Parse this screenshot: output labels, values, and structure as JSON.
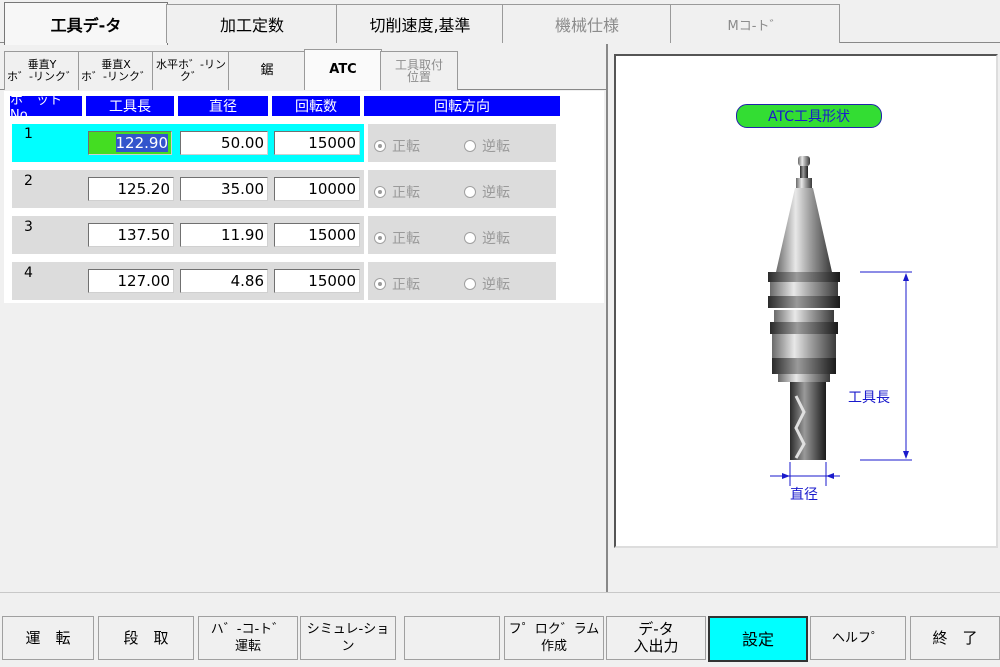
{
  "main_tabs": [
    {
      "label": "工具デ-タ",
      "state": "active"
    },
    {
      "label": "加工定数",
      "state": "normal"
    },
    {
      "label": "切削速度,基準",
      "state": "normal"
    },
    {
      "label": "機械仕様",
      "state": "disabled"
    },
    {
      "label": "Mコ-ト゛",
      "state": "disabled"
    }
  ],
  "sub_tabs": [
    {
      "label": "垂直Y\nホ゛-リンク゛",
      "state": "normal"
    },
    {
      "label": "垂直X\nホ゛-リンク゛",
      "state": "normal"
    },
    {
      "label": "水平ホ゛-リン\nク゛",
      "state": "normal"
    },
    {
      "label": "鋸",
      "state": "normal"
    },
    {
      "label": "ATC",
      "state": "active"
    },
    {
      "label": "工具取付\n位置",
      "state": "disabled"
    }
  ],
  "table": {
    "headers": [
      "ホ゜ット゛No.",
      "工具長",
      "直径",
      "回転数",
      "回転方向"
    ],
    "rows": [
      {
        "pot": "1",
        "length": "122.90",
        "diameter": "50.00",
        "rpm": "15000",
        "forward": "正転",
        "reverse": "逆転",
        "selected": true
      },
      {
        "pot": "2",
        "length": "125.20",
        "diameter": "35.00",
        "rpm": "10000",
        "forward": "正転",
        "reverse": "逆転",
        "selected": false
      },
      {
        "pot": "3",
        "length": "137.50",
        "diameter": "11.90",
        "rpm": "15000",
        "forward": "正転",
        "reverse": "逆転",
        "selected": false
      },
      {
        "pot": "4",
        "length": "127.00",
        "diameter": "4.86",
        "rpm": "15000",
        "forward": "正転",
        "reverse": "逆転",
        "selected": false
      }
    ]
  },
  "diagram": {
    "title": "ATC工具形状",
    "length_label": "工具長",
    "diameter_label": "直径"
  },
  "buttons": [
    {
      "label": "運　転",
      "highlight": false
    },
    {
      "label": "段　取",
      "highlight": false
    },
    {
      "label": "ハ゛-コ-ト゛\n運転",
      "highlight": false
    },
    {
      "label": "シミュレ-ション",
      "highlight": false
    },
    {
      "label": "",
      "highlight": false
    },
    {
      "label": "フ゜ロク゛ラム\n作成",
      "highlight": false
    },
    {
      "label": "デ-タ\n入出力",
      "highlight": false
    },
    {
      "label": "設定",
      "highlight": true
    },
    {
      "label": "ヘルフ゜",
      "highlight": false
    },
    {
      "label": "終　了",
      "highlight": false
    }
  ],
  "colors": {
    "header_bg": "#0000ff",
    "selected_row": "#00ffff",
    "active_input": "#44dd22",
    "highlight_button": "#00ffff"
  }
}
